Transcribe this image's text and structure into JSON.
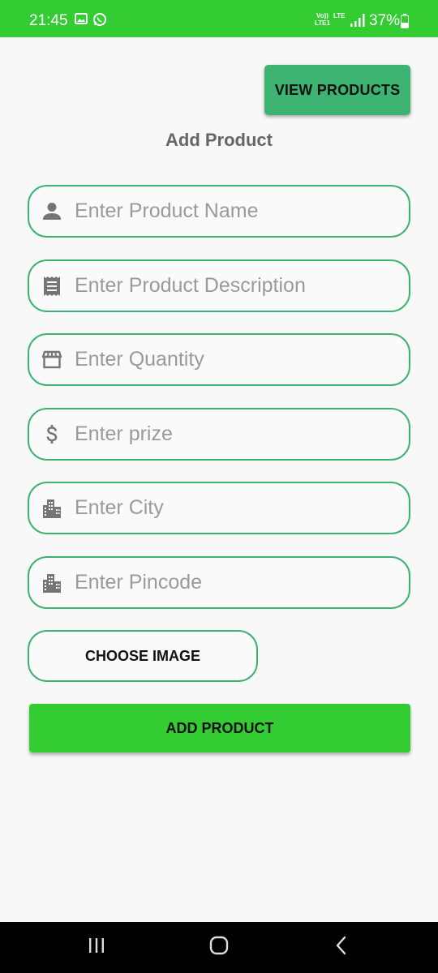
{
  "status_bar": {
    "time": "21:45",
    "network_top": "Vo))",
    "network_bottom": "LTE1",
    "lte_label": "LTE",
    "battery_percent": "37%",
    "icons": [
      "gallery-icon",
      "whatsapp-icon",
      "signal-icon",
      "battery-icon"
    ]
  },
  "header": {
    "view_products_label": "VIEW PRODUCTS",
    "title": "Add Product"
  },
  "form": {
    "fields": [
      {
        "icon": "person-icon",
        "placeholder": "Enter Product Name",
        "value": ""
      },
      {
        "icon": "receipt-icon",
        "placeholder": "Enter Product Description",
        "value": ""
      },
      {
        "icon": "store-icon",
        "placeholder": "Enter Quantity",
        "value": ""
      },
      {
        "icon": "dollar-icon",
        "placeholder": "Enter prize",
        "value": ""
      },
      {
        "icon": "city-icon",
        "placeholder": "Enter City",
        "value": ""
      },
      {
        "icon": "city-icon",
        "placeholder": "Enter Pincode",
        "value": ""
      }
    ],
    "choose_image_label": "CHOOSE IMAGE",
    "add_product_label": "ADD PRODUCT"
  },
  "colors": {
    "accent_green": "#33cc33",
    "button_green": "#3cb371",
    "border_green": "#3cb371",
    "placeholder_gray": "#9a9a9a",
    "icon_gray": "#757575"
  },
  "nav_bar": {
    "icons": [
      "recent-apps-icon",
      "home-icon",
      "back-icon"
    ]
  }
}
